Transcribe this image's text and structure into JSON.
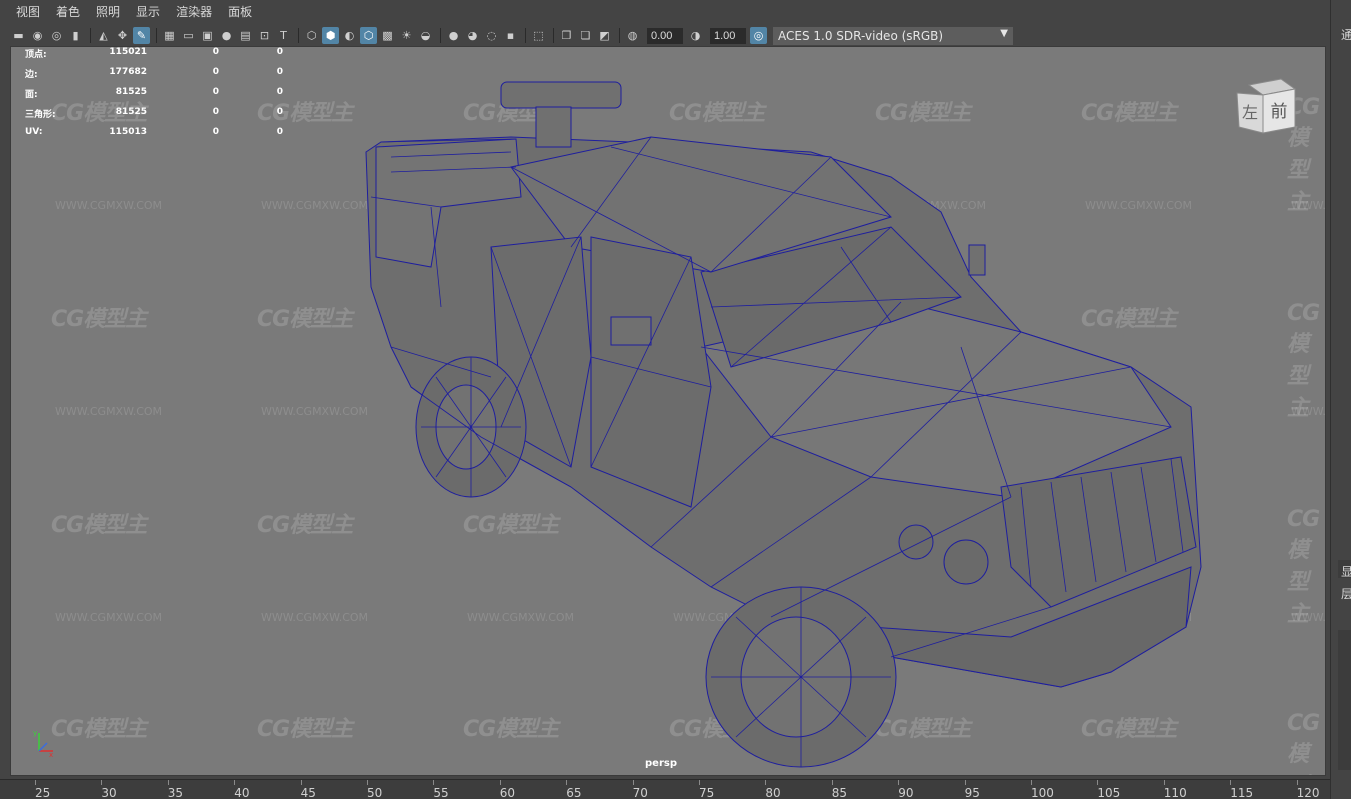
{
  "menu": [
    "视图",
    "着色",
    "照明",
    "显示",
    "渲染器",
    "面板"
  ],
  "toolbar": {
    "exposure_value": "0.00",
    "gamma_value": "1.00",
    "color_space": "ACES 1.0 SDR-video (sRGB)",
    "icons": [
      "camera-icon",
      "camera-attr-icon",
      "bookmark-icon",
      "image-plane-icon",
      "grid-icon",
      "film-gate-icon",
      "resolution-gate-icon",
      "wireframe-icon",
      "smooth-shade-icon",
      "textured-icon",
      "lights-icon",
      "shadows-icon",
      "isolate-icon",
      "xray-icon"
    ]
  },
  "hud": {
    "rows": [
      {
        "label": "顶点:",
        "v1": "115021",
        "v2": "0",
        "v3": "0"
      },
      {
        "label": "边:",
        "v1": "177682",
        "v2": "0",
        "v3": "0"
      },
      {
        "label": "面:",
        "v1": "81525",
        "v2": "0",
        "v3": "0"
      },
      {
        "label": "三角形:",
        "v1": "81525",
        "v2": "0",
        "v3": "0"
      },
      {
        "label": "UV:",
        "v1": "115013",
        "v2": "0",
        "v3": "0"
      }
    ]
  },
  "viewcube": {
    "left": "左",
    "front": "前"
  },
  "camera_label": "persp",
  "watermark": {
    "text": "CG模型主",
    "url": "WWW.CGMXW.COM"
  },
  "right_panel_chars": [
    "通",
    "显",
    "层"
  ],
  "ruler": {
    "ticks": [
      "25",
      "30",
      "35",
      "40",
      "45",
      "50",
      "55",
      "60",
      "65",
      "70",
      "75",
      "80",
      "85",
      "90",
      "95",
      "100",
      "105",
      "110",
      "115",
      "120"
    ]
  }
}
